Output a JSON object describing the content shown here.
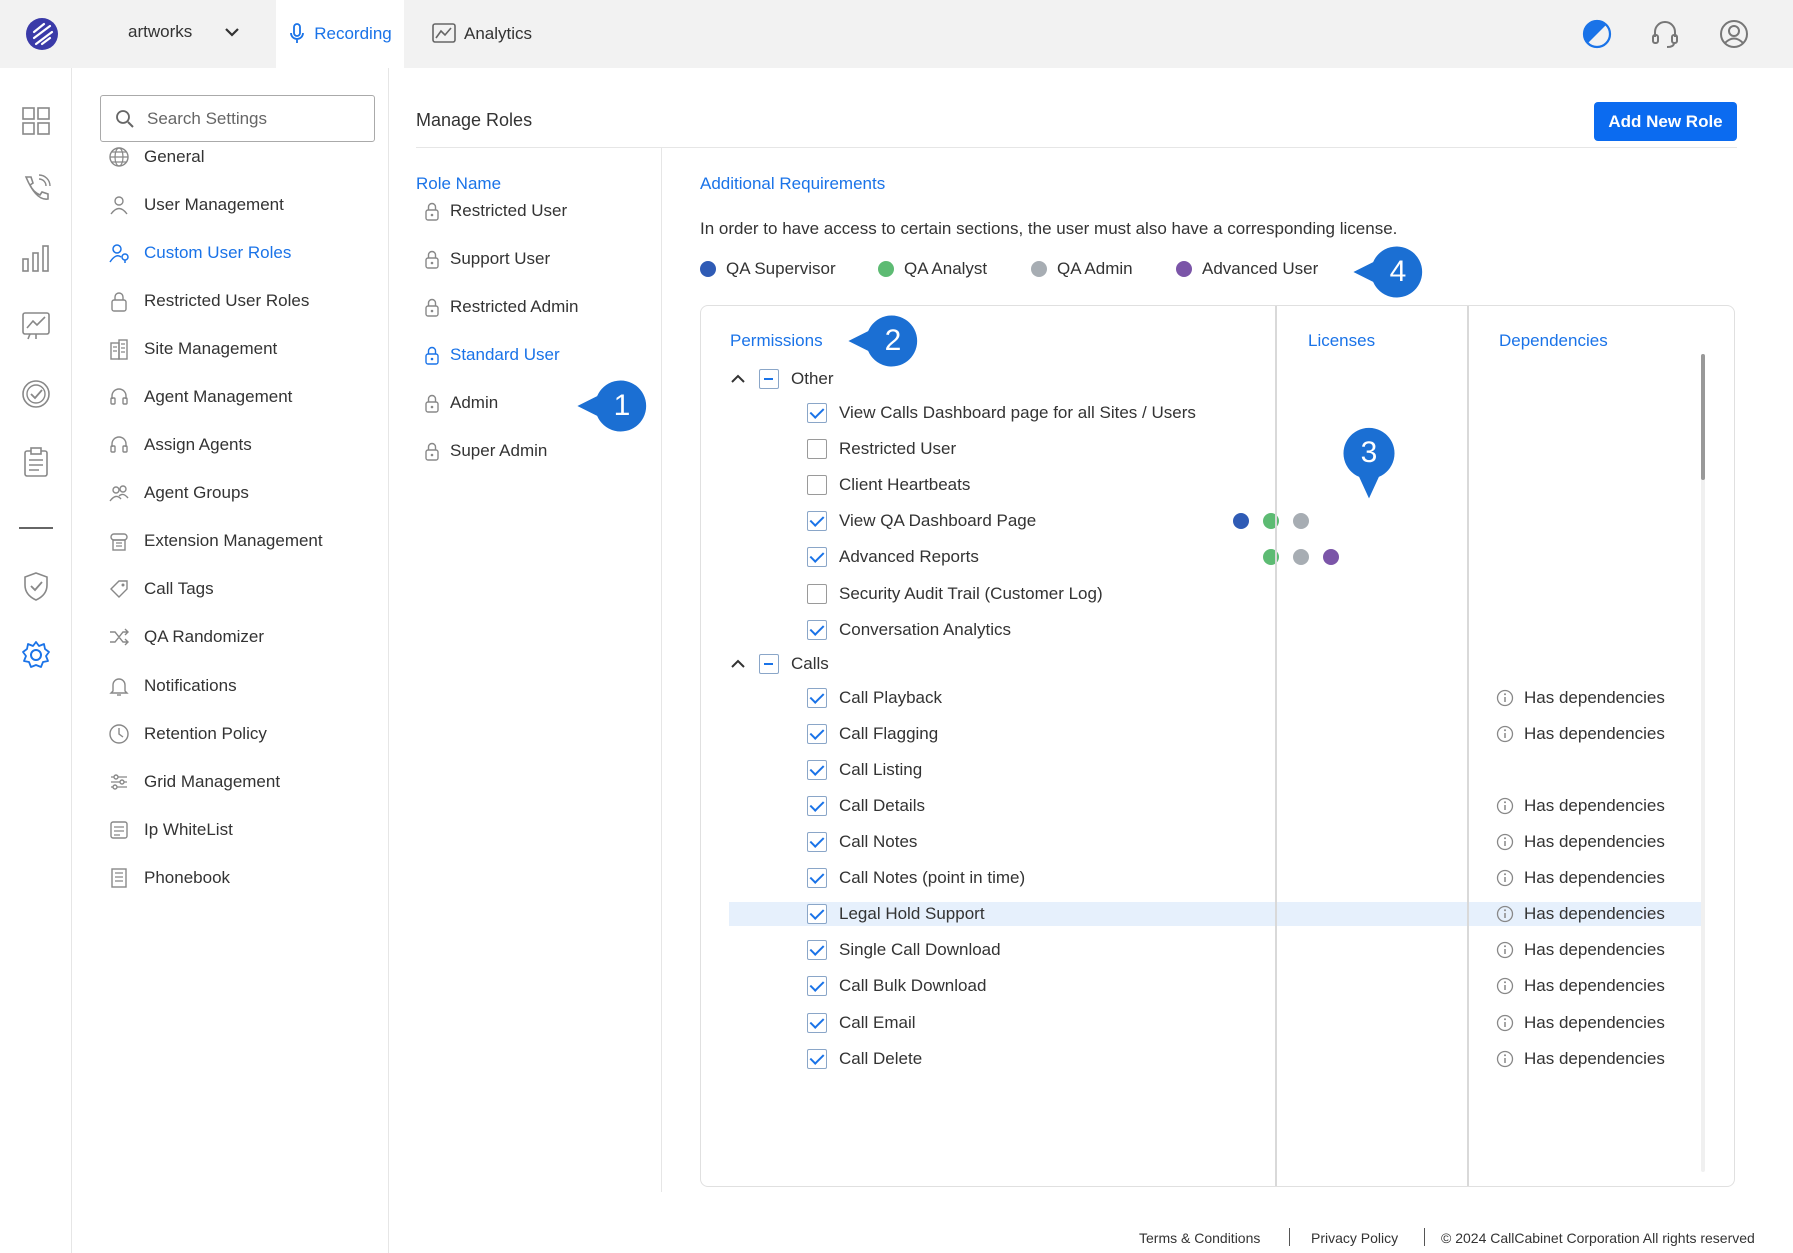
{
  "header": {
    "workspace": "artworks",
    "tabs": [
      {
        "label": "Recording"
      },
      {
        "label": "Analytics"
      }
    ]
  },
  "settings_nav": {
    "search_placeholder": "Search Settings",
    "items": [
      {
        "label": "General",
        "icon": "globe-icon"
      },
      {
        "label": "User Management",
        "icon": "user-icon"
      },
      {
        "label": "Custom User Roles",
        "icon": "user-key-icon"
      },
      {
        "label": "Restricted User Roles",
        "icon": "lock-icon"
      },
      {
        "label": "Site Management",
        "icon": "building-icon"
      },
      {
        "label": "Agent Management",
        "icon": "headset-icon"
      },
      {
        "label": "Assign Agents",
        "icon": "headset-icon"
      },
      {
        "label": "Agent Groups",
        "icon": "group-icon"
      },
      {
        "label": "Extension Management",
        "icon": "phone-icon"
      },
      {
        "label": "Call Tags",
        "icon": "tag-icon"
      },
      {
        "label": "QA Randomizer",
        "icon": "shuffle-icon"
      },
      {
        "label": "Notifications",
        "icon": "bell-icon"
      },
      {
        "label": "Retention Policy",
        "icon": "clock-icon"
      },
      {
        "label": "Grid Management",
        "icon": "sliders-icon"
      },
      {
        "label": "Ip WhiteList",
        "icon": "list-icon"
      },
      {
        "label": "Phonebook",
        "icon": "book-icon"
      }
    ]
  },
  "main": {
    "title": "Manage Roles",
    "add_button": "Add New Role",
    "role_header": "Role Name",
    "roles": [
      "Restricted User",
      "Support User",
      "Restricted Admin",
      "Standard User",
      "Admin",
      "Super Admin"
    ],
    "requirements_header": "Additional Requirements",
    "requirements_text": "In order to have access to certain sections, the user must also have a corresponding license.",
    "legend": [
      {
        "label": "QA Supervisor",
        "color": "#2f5bb5"
      },
      {
        "label": "QA Analyst",
        "color": "#5dbb73"
      },
      {
        "label": "QA Admin",
        "color": "#a7adb3"
      },
      {
        "label": "Advanced User",
        "color": "#7b55a8"
      }
    ],
    "columns": {
      "permissions": "Permissions",
      "licenses": "Licenses",
      "dependencies": "Dependencies"
    },
    "groups": [
      {
        "label": "Other",
        "items": [
          {
            "label": "View Calls Dashboard page for all Sites / Users",
            "checked": true,
            "dep": ""
          },
          {
            "label": "Restricted User",
            "checked": false,
            "dep": ""
          },
          {
            "label": "Client Heartbeats",
            "checked": false,
            "dep": ""
          },
          {
            "label": "View QA Dashboard Page",
            "checked": true,
            "dep": ""
          },
          {
            "label": "Advanced Reports",
            "checked": true,
            "dep": ""
          },
          {
            "label": "Security Audit Trail (Customer Log)",
            "checked": false,
            "dep": ""
          },
          {
            "label": "Conversation Analytics",
            "checked": true,
            "dep": ""
          }
        ]
      },
      {
        "label": "Calls",
        "items": [
          {
            "label": "Call Playback",
            "checked": true,
            "dep": "Has dependencies"
          },
          {
            "label": "Call Flagging",
            "checked": true,
            "dep": "Has dependencies"
          },
          {
            "label": "Call Listing",
            "checked": true,
            "dep": ""
          },
          {
            "label": "Call Details",
            "checked": true,
            "dep": "Has dependencies"
          },
          {
            "label": "Call Notes",
            "checked": true,
            "dep": "Has dependencies"
          },
          {
            "label": "Call Notes (point in time)",
            "checked": true,
            "dep": "Has dependencies"
          },
          {
            "label": "Legal Hold Support",
            "checked": true,
            "dep": "Has dependencies"
          },
          {
            "label": "Single Call Download",
            "checked": true,
            "dep": "Has dependencies"
          },
          {
            "label": "Call Bulk Download",
            "checked": true,
            "dep": "Has dependencies"
          },
          {
            "label": "Call Email",
            "checked": true,
            "dep": "Has dependencies"
          },
          {
            "label": "Call Delete",
            "checked": true,
            "dep": "Has dependencies"
          }
        ]
      }
    ],
    "licenses": {
      "View QA Dashboard Page": [
        "QA Supervisor",
        "QA Analyst",
        "QA Admin"
      ],
      "Advanced Reports": [
        "QA Analyst",
        "QA Admin",
        "Advanced User"
      ]
    },
    "callouts": [
      "1",
      "2",
      "3",
      "4"
    ]
  },
  "footer": {
    "terms": "Terms & Conditions",
    "privacy": "Privacy Policy",
    "copyright": "© 2024 CallCabinet Corporation All rights reserved"
  }
}
